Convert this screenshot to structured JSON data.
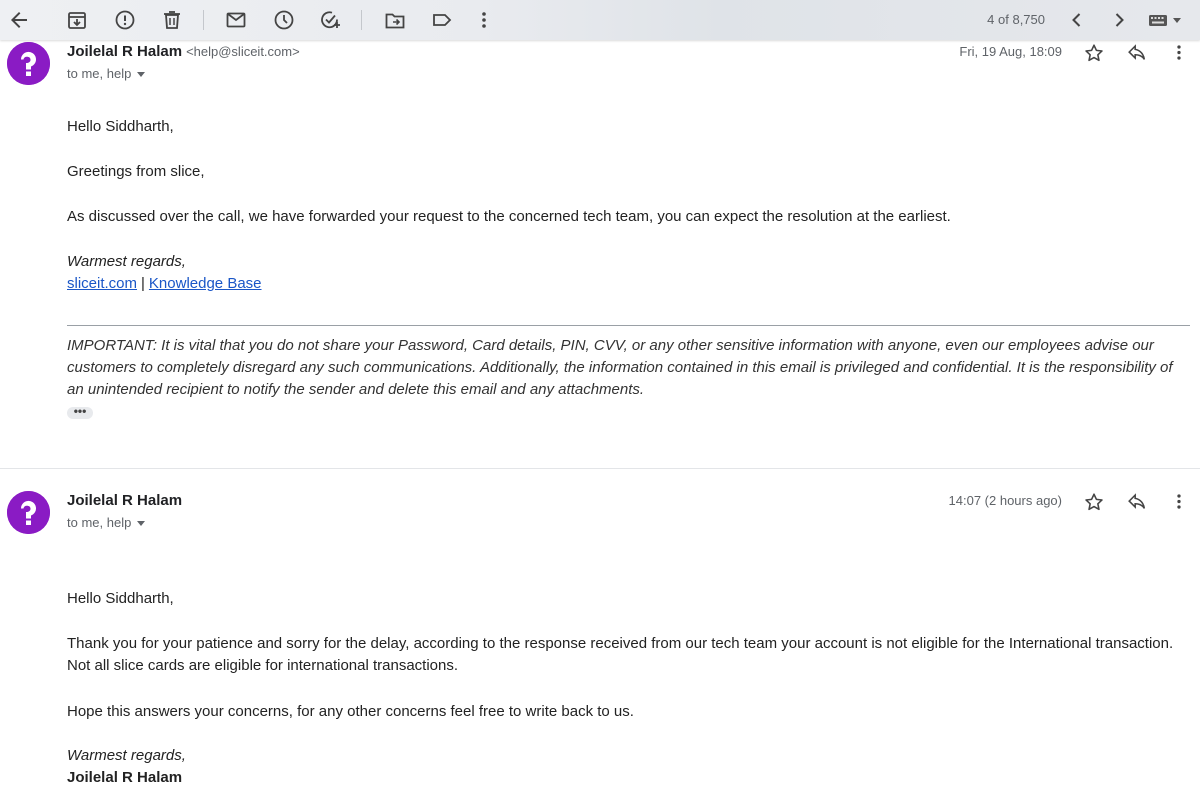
{
  "toolbar": {
    "counter": "4 of 8,750",
    "icons": [
      "back-icon",
      "archive-icon",
      "report-spam-icon",
      "delete-icon",
      "mark-unread-icon",
      "snooze-icon",
      "add-task-icon",
      "move-to-icon",
      "label-icon",
      "more-vert-icon",
      "newer-icon",
      "older-icon",
      "input-tools-icon"
    ]
  },
  "messages": [
    {
      "sender_name": "Joilelal R Halam",
      "sender_email": "<help@sliceit.com>",
      "recipients": "to me, help",
      "date": "Fri, 19 Aug, 18:09",
      "body": {
        "greeting": "Hello Siddharth,",
        "line1": "Greetings from slice,",
        "line2": "As discussed over the call, we have forwarded your request to the concerned tech team, you can expect the resolution at the earliest.",
        "regards": "Warmest regards,",
        "link1": "sliceit.com",
        "pipe": "|",
        "link2": "Knowledge Base",
        "disclaimer": "IMPORTANT: It is vital that you do not share your Password, Card details, PIN, CVV, or any other sensitive information with anyone, even our employees advise our customers to completely disregard any such communications. Additionally, the information contained in this email is privileged and confidential. It is the responsibility of an unintended recipient to notify the sender and delete this email and any attachments.",
        "ellipsis": "•••"
      }
    },
    {
      "sender_name": "Joilelal R Halam",
      "recipients": "to me, help",
      "date": "14:07 (2 hours ago)",
      "body": {
        "greeting": "Hello Siddharth,",
        "line1": "Thank you for your patience and sorry for the delay, according to the response received from our tech team your account is not eligible for the International transaction.",
        "line2": "Not all slice cards are eligible for international transactions.",
        "line3": "Hope this answers your concerns, for any other concerns feel free to write back to us.",
        "regards": "Warmest regards,",
        "signature": "Joilelal R Halam"
      }
    }
  ],
  "colors": {
    "avatar": "#8a1bc4",
    "link": "#1a56c7",
    "toolbar_bg": "#e9ebef"
  }
}
